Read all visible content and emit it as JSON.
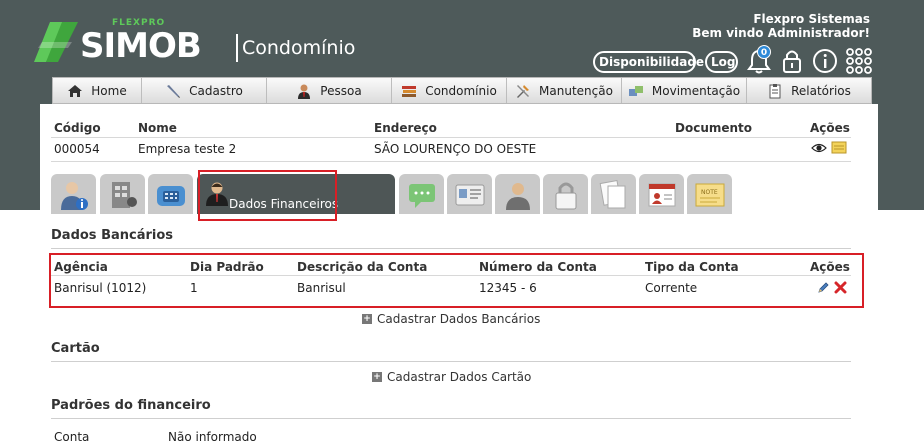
{
  "brand": {
    "flexpro": "FLEXPRO",
    "simob": "SIMOB",
    "module": "Condomínio"
  },
  "welcome": {
    "company": "Flexpro Sistemas",
    "greeting": "Bem vindo Administrador!"
  },
  "header_actions": {
    "availability_label": "Disponibilidade",
    "log_label": "Log",
    "notifications_count": "0"
  },
  "nav": [
    {
      "label": "Home",
      "icon": "home-icon"
    },
    {
      "label": "Cadastro",
      "icon": "pen-icon"
    },
    {
      "label": "Pessoa",
      "icon": "person-icon"
    },
    {
      "label": "Condomínio",
      "icon": "books-icon"
    },
    {
      "label": "Manutenção",
      "icon": "tools-icon"
    },
    {
      "label": "Movimentação",
      "icon": "transfer-icon"
    },
    {
      "label": "Relatórios",
      "icon": "report-icon"
    }
  ],
  "entity_table": {
    "headers": {
      "codigo": "Código",
      "nome": "Nome",
      "endereco": "Endereço",
      "documento": "Documento",
      "acoes": "Ações"
    },
    "row": {
      "codigo": "000054",
      "nome": "Empresa teste 2",
      "endereco": "SÃO LOURENÇO DO OESTE",
      "documento": ""
    }
  },
  "tabs": {
    "active_label": "Dados Financeiros"
  },
  "bank_section": {
    "title": "Dados Bancários",
    "headers": {
      "agencia": "Agência",
      "dia_padrao": "Dia Padrão",
      "descricao": "Descrição da Conta",
      "numero": "Número da Conta",
      "tipo": "Tipo da Conta",
      "acoes": "Ações"
    },
    "row": {
      "agencia": "Banrisul (1012)",
      "dia_padrao": "1",
      "descricao": "Banrisul",
      "numero": "12345 - 6",
      "tipo": "Corrente"
    },
    "add_label": "Cadastrar Dados Bancários"
  },
  "card_section": {
    "title": "Cartão",
    "add_label": "Cadastrar Dados Cartão"
  },
  "finance_section": {
    "title": "Padrões do financeiro",
    "field_label": "Conta",
    "field_value": "Não informado"
  },
  "colors": {
    "header_bg": "#4e5a5a",
    "accent_green": "#5ec95a",
    "highlight_red": "#d81f26",
    "badge_blue": "#2e8ad8"
  }
}
